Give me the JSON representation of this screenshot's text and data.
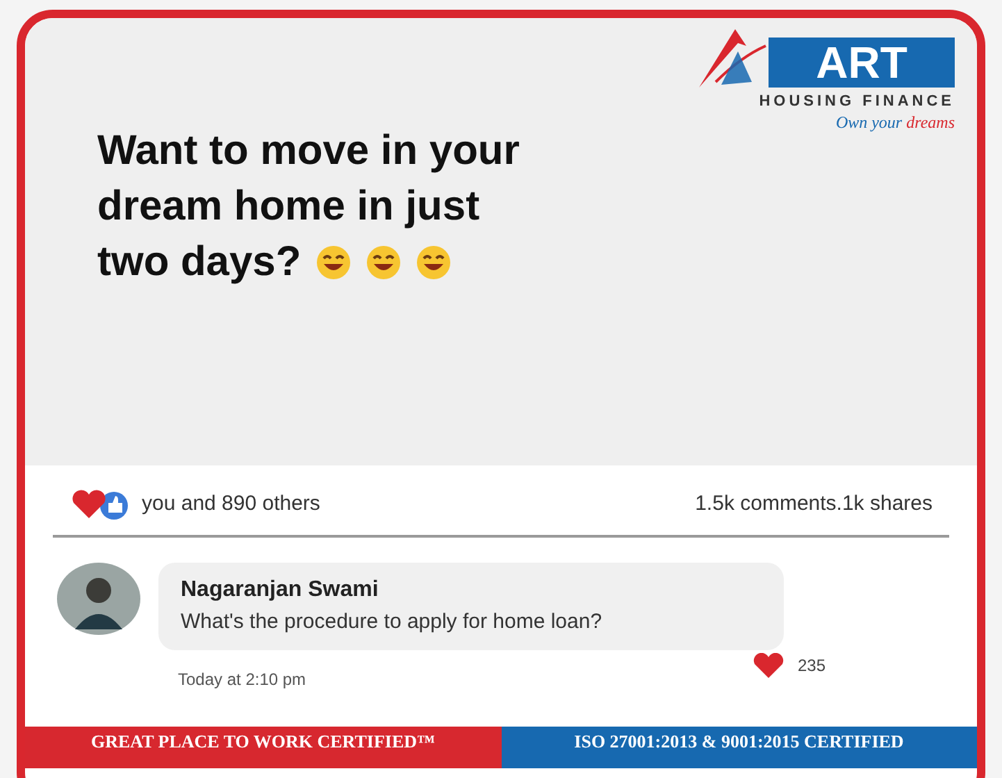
{
  "logo": {
    "name": "ART",
    "subtitle": "HOUSING FINANCE",
    "tagline": "Own your",
    "tagline_accent": "dreams"
  },
  "headline": [
    "Want to move in your",
    "dream home in just",
    "two days?"
  ],
  "reactions": {
    "text": "you and 890 others",
    "stats": "1.5k comments.1k shares"
  },
  "comment": {
    "author": "Nagaranjan Swami",
    "text": "What's the procedure to apply for home loan?",
    "likes": "235",
    "time": "Today at 2:10 pm"
  },
  "banner": [
    {
      "text": "GREAT PLACE TO WORK CERTIFIED™",
      "color": "#d7282f"
    },
    {
      "text": "ISO 27001:2013 & 9001:2015 CERTIFIED",
      "color": "#1769b0"
    }
  ]
}
